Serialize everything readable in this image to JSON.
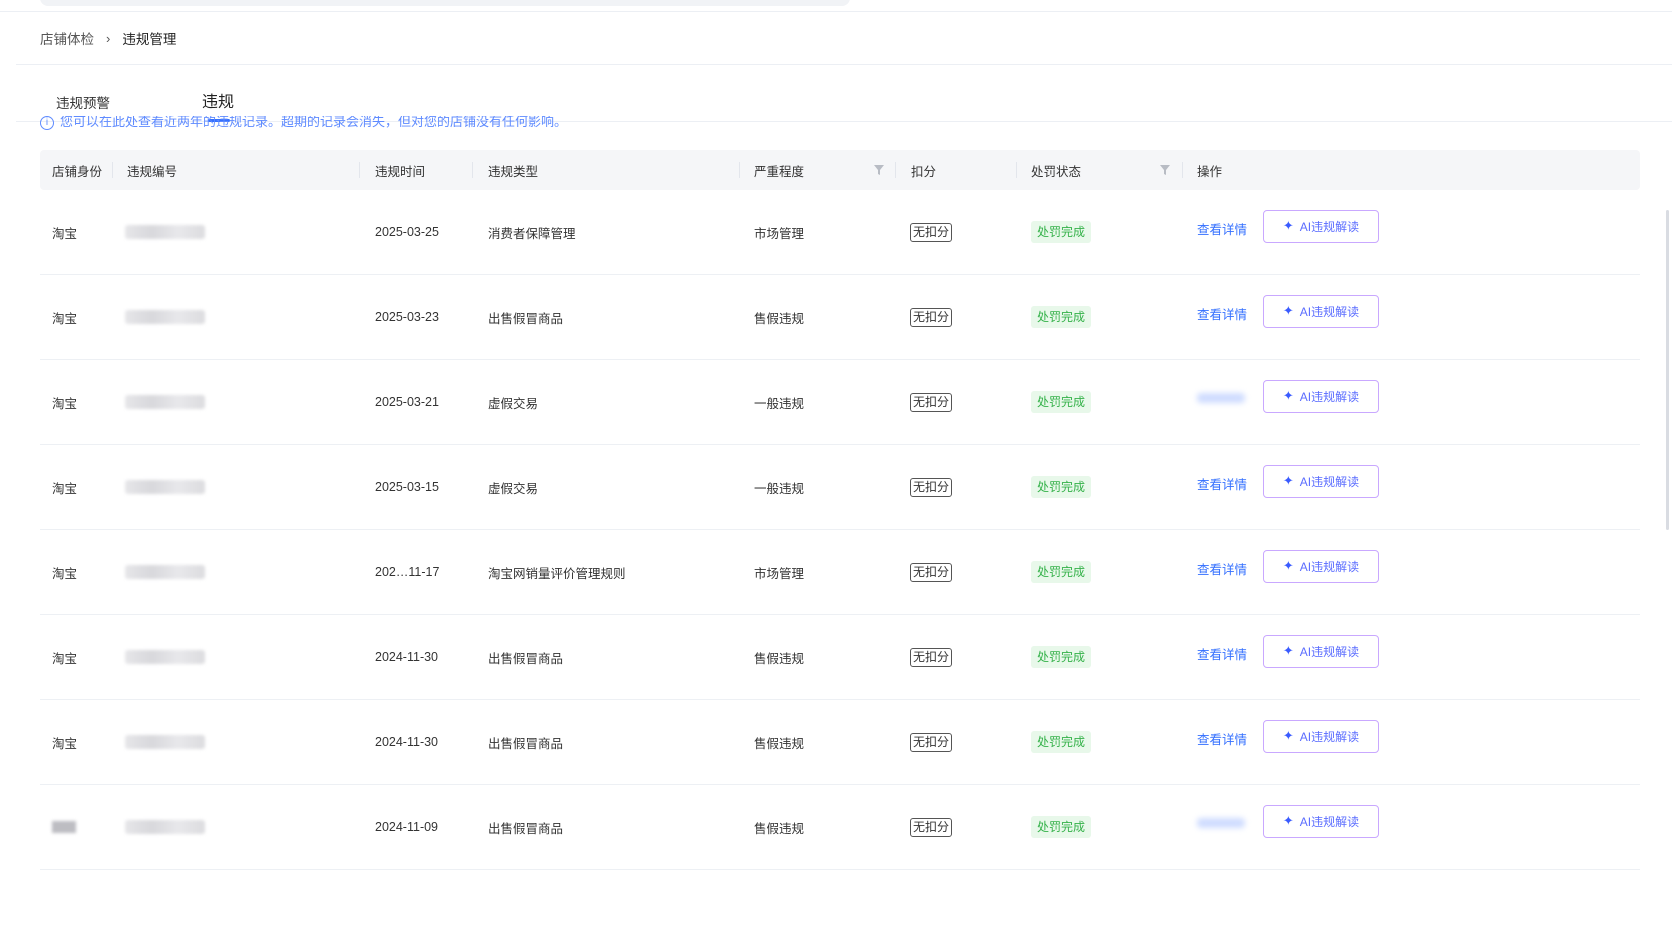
{
  "breadcrumb": {
    "parent": "店铺体检",
    "separator": "›",
    "current": "违规管理"
  },
  "tabs": {
    "warning": "违规预警",
    "violation": "违规"
  },
  "notice": {
    "icon": "info-icon",
    "text": "您可以在此处查看近两年的违规记录。超期的记录会消失，但对您的店铺没有任何影响。"
  },
  "table": {
    "headers": {
      "store_identity": "店铺身份",
      "violation_no": "违规编号",
      "violation_time": "违规时间",
      "violation_type": "违规类型",
      "severity": "严重程度",
      "deduction": "扣分",
      "penalty_status": "处罚状态",
      "operations": "操作"
    },
    "filter_icon": "filter-icon",
    "rows": [
      {
        "store": "淘宝",
        "time": "2025-03-25",
        "type": "消费者保障管理",
        "severity": "市场管理",
        "score": "无扣分",
        "status": "处罚完成",
        "detail": "查看详情",
        "ai": "AI违规解读"
      },
      {
        "store": "淘宝",
        "time": "2025-03-23",
        "type": "出售假冒商品",
        "severity": "售假违规",
        "score": "无扣分",
        "status": "处罚完成",
        "detail": "查看详情",
        "ai": "AI违规解读"
      },
      {
        "store": "淘宝",
        "time": "2025-03-21",
        "type": "虚假交易",
        "severity": "一般违规",
        "score": "无扣分",
        "status": "处罚完成",
        "detail": "",
        "ai": "AI违规解读"
      },
      {
        "store": "淘宝",
        "time": "2025-03-15",
        "type": "虚假交易",
        "severity": "一般违规",
        "score": "无扣分",
        "status": "处罚完成",
        "detail": "查看详情",
        "ai": "AI违规解读"
      },
      {
        "store": "淘宝",
        "time": "202…11-17",
        "type": "淘宝网销量评价管理规则",
        "severity": "市场管理",
        "score": "无扣分",
        "status": "处罚完成",
        "detail": "查看详情",
        "ai": "AI违规解读"
      },
      {
        "store": "淘宝",
        "time": "2024-11-30",
        "type": "出售假冒商品",
        "severity": "售假违规",
        "score": "无扣分",
        "status": "处罚完成",
        "detail": "查看详情",
        "ai": "AI违规解读"
      },
      {
        "store": "淘宝",
        "time": "2024-11-30",
        "type": "出售假冒商品",
        "severity": "售假违规",
        "score": "无扣分",
        "status": "处罚完成",
        "detail": "查看详情",
        "ai": "AI违规解读"
      },
      {
        "store": "",
        "time": "2024-11-09",
        "type": "出售假冒商品",
        "severity": "售假违规",
        "score": "无扣分",
        "status": "处罚完成",
        "detail": "",
        "ai": "AI违规解读"
      }
    ]
  },
  "colors": {
    "accent": "#3470ff",
    "status_green": "#35b24a",
    "status_bg": "#e8f8ea",
    "ai_border": "#c9a8ff"
  }
}
